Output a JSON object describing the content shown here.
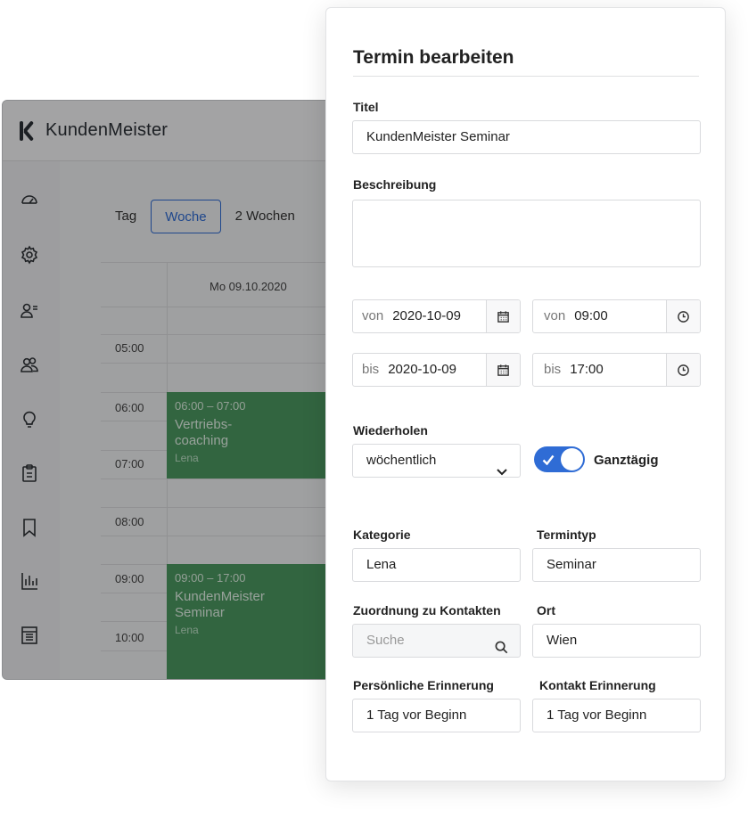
{
  "app": {
    "brand": "KundenMeister",
    "view_tabs": [
      {
        "label": "Tag",
        "active": false
      },
      {
        "label": "Woche",
        "active": true
      },
      {
        "label": "2 Wochen",
        "active": false
      }
    ],
    "calendar": {
      "day_header": "Mo 09.10.2020",
      "hours": [
        "05:00",
        "06:00",
        "07:00",
        "08:00",
        "09:00",
        "10:00"
      ],
      "events": [
        {
          "time": "06:00 – 07:00",
          "name": "Vertriebs-coaching",
          "name_lines": [
            "Vertriebs-",
            "coaching"
          ],
          "person": "Lena"
        },
        {
          "time": "09:00 – 17:00",
          "name": "KundenMeister Seminar",
          "name_lines": [
            "KundenMeister",
            "Seminar"
          ],
          "person": "Lena"
        }
      ]
    },
    "sidebar_icons": [
      "dashboard-icon",
      "gear-icon",
      "contact-list-icon",
      "users-icon",
      "lightbulb-icon",
      "clipboard-icon",
      "bookmark-icon",
      "bar-chart-icon",
      "table-icon"
    ]
  },
  "dialog": {
    "title": "Termin bearbeiten",
    "titel": {
      "label": "Titel",
      "value": "KundenMeister Seminar"
    },
    "beschreibung": {
      "label": "Beschreibung",
      "value": ""
    },
    "von_datum": {
      "prefix": "von",
      "value": "2020-10-09"
    },
    "von_zeit": {
      "prefix": "von",
      "value": "09:00"
    },
    "bis_datum": {
      "prefix": "bis",
      "value": "2020-10-09"
    },
    "bis_zeit": {
      "prefix": "bis",
      "value": "17:00"
    },
    "wiederholen": {
      "label": "Wiederholen",
      "value": "wöchentlich"
    },
    "ganztaegig": {
      "label": "Ganztägig",
      "checked": true
    },
    "kategorie": {
      "label": "Kategorie",
      "value": "Lena"
    },
    "termintyp": {
      "label": "Termintyp",
      "value": "Seminar"
    },
    "zuordnung": {
      "label": "Zuordnung zu Kontakten",
      "placeholder": "Suche"
    },
    "ort": {
      "label": "Ort",
      "value": "Wien"
    },
    "persoenliche_erinnerung": {
      "label": "Persönliche Erinnerung",
      "value": "1 Tag vor Beginn"
    },
    "kontakt_erinnerung": {
      "label": "Kontakt Erinnerung",
      "value": "1 Tag vor Beginn"
    }
  },
  "colors": {
    "accent": "#2f6cd5",
    "event_green": "#4d9a62"
  }
}
